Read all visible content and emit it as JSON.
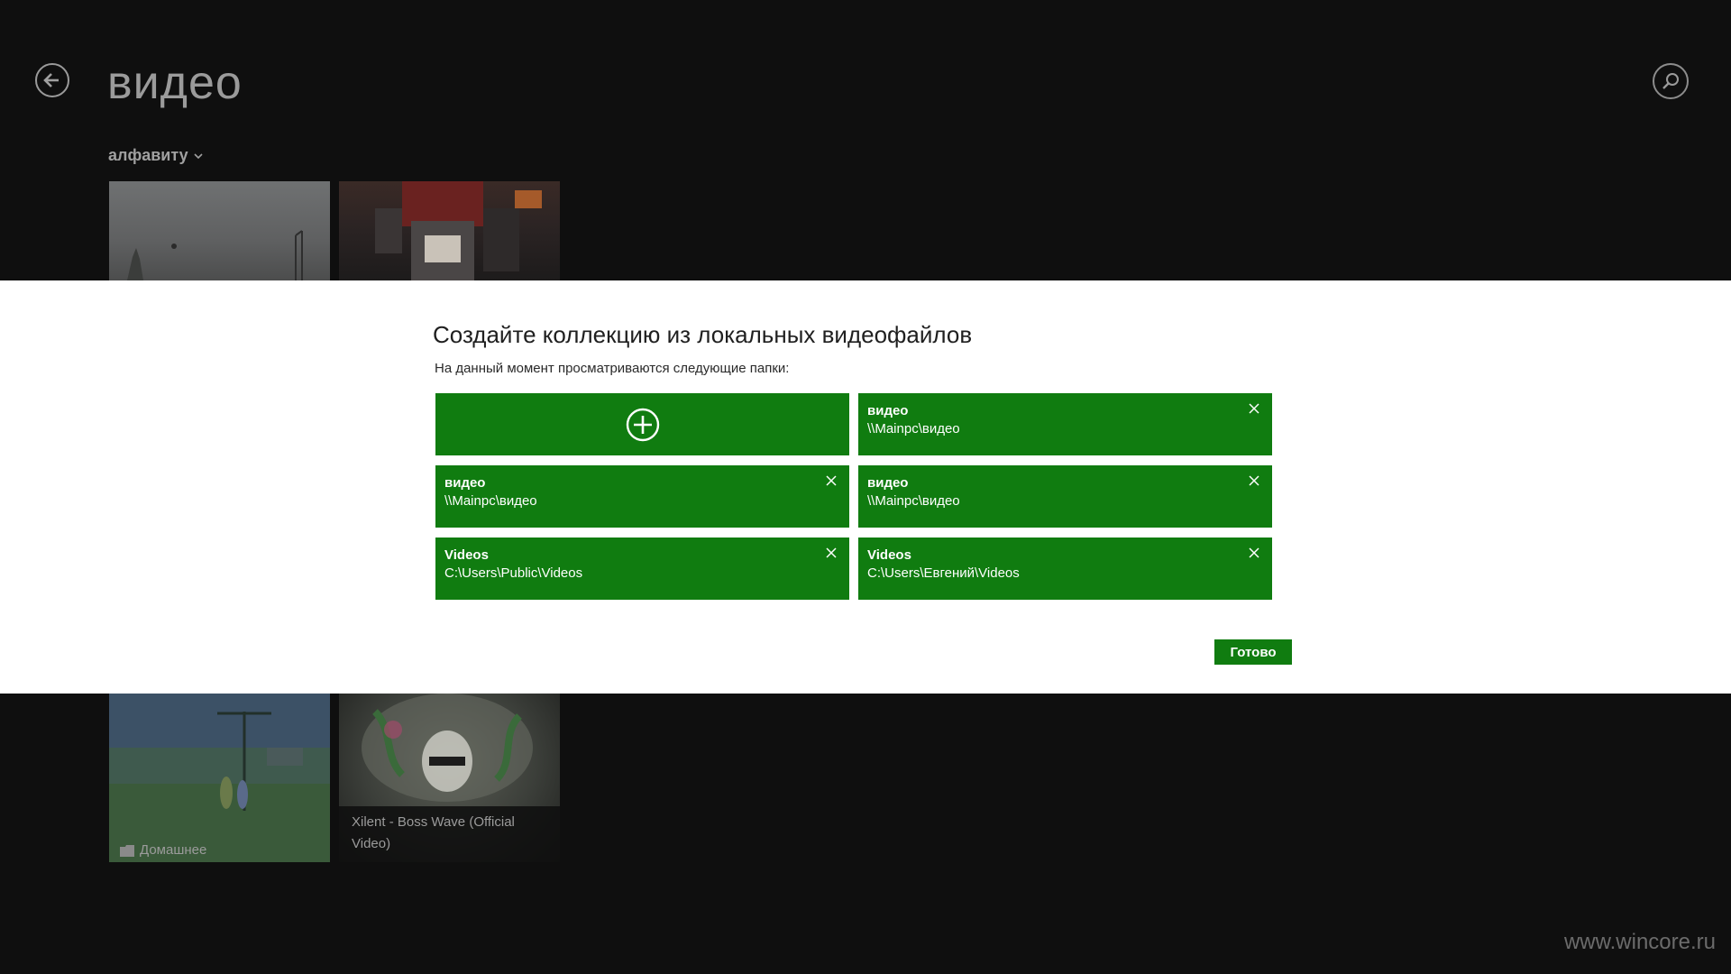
{
  "header": {
    "title": "видео",
    "sort_label": "алфавиту"
  },
  "background_tiles": [
    {
      "label": ""
    },
    {
      "label": ""
    },
    {
      "label": "Домашнее"
    },
    {
      "label": "Xilent - Boss Wave (Official Video)"
    }
  ],
  "dialog": {
    "title": "Создайте коллекцию из локальных видеофайлов",
    "subtitle": "На данный момент просматриваются следующие папки:",
    "folders": [
      {
        "name": "видео",
        "path": "\\\\Mainpc\\видео"
      },
      {
        "name": "видео",
        "path": "\\\\Mainpc\\видео"
      },
      {
        "name": "видео",
        "path": "\\\\Mainpc\\видео"
      },
      {
        "name": "Videos",
        "path": "C:\\Users\\Public\\Videos"
      },
      {
        "name": "Videos",
        "path": "C:\\Users\\Евгений\\Videos"
      }
    ],
    "done_label": "Готово"
  },
  "watermark": "www.wincore.ru",
  "colors": {
    "accent": "#107c10",
    "background": "#0f0f0f",
    "dialog_bg": "#ffffff"
  },
  "icons": {
    "back": "back-arrow-icon",
    "search": "search-icon",
    "sort": "chevron-down-icon",
    "add": "plus-circle-icon",
    "remove": "close-icon",
    "folder": "folder-icon"
  }
}
